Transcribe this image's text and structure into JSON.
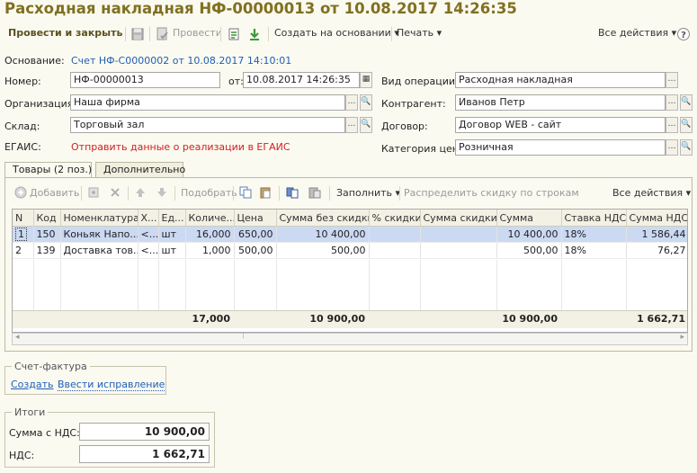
{
  "title": "Расходная накладная НФ-00000013 от 10.08.2017 14:26:35",
  "toolbar": {
    "post_close": "Провести и закрыть",
    "post": "Провести",
    "create_based": "Создать на основании",
    "print": "Печать",
    "all_actions": "Все действия"
  },
  "form": {
    "basis_label": "Основание:",
    "basis_value": "Счет НФ-С0000002 от 10.08.2017 14:10:01",
    "number_label": "Номер:",
    "number_value": "НФ-00000013",
    "date_label": "от:",
    "date_value": "10.08.2017 14:26:35",
    "org_label": "Организация:",
    "org_value": "Наша фирма",
    "warehouse_label": "Склад:",
    "warehouse_value": "Торговый зал",
    "egais_label": "ЕГАИС:",
    "egais_value": "Отправить данные о реализации в ЕГАИС",
    "op_label": "Вид операции:",
    "op_value": "Расходная накладная",
    "counterparty_label": "Контрагент:",
    "counterparty_value": "Иванов Петр",
    "contract_label": "Договор:",
    "contract_value": "Договор WEB - сайт",
    "price_cat_label": "Категория цен:",
    "price_cat_value": "Розничная"
  },
  "tabs": [
    "Товары (2 поз.)",
    "Дополнительно"
  ],
  "table_toolbar": {
    "add": "Добавить",
    "pick": "Подобрать",
    "fill": "Заполнить",
    "distribute": "Распределить скидку по строкам",
    "all_actions": "Все действия"
  },
  "table": {
    "columns": [
      "N",
      "Код",
      "Номенклатура",
      "Х...",
      "Ед...",
      "Количе...",
      "Цена",
      "Сумма без скидки",
      "% скидки",
      "Сумма скидки",
      "Сумма",
      "Ставка НДС",
      "Сумма НДС"
    ],
    "rows": [
      [
        "1",
        "150",
        "Коньяк Напо...",
        "<...",
        "шт",
        "16,000",
        "650,00",
        "10 400,00",
        "",
        "",
        "10 400,00",
        "18%",
        "1 586,44"
      ],
      [
        "2",
        "139",
        "Доставка тов...",
        "<...",
        "шт",
        "1,000",
        "500,00",
        "500,00",
        "",
        "",
        "500,00",
        "18%",
        "76,27"
      ]
    ],
    "totals": {
      "quantity": "17,000",
      "sum_no_discount": "10 900,00",
      "sum": "10 900,00",
      "vat": "1 662,71"
    }
  },
  "invoice": {
    "title": "Счет-фактура",
    "create": "Создать",
    "correction": "Ввести исправление"
  },
  "totals": {
    "title": "Итоги",
    "sum_label": "Сумма с НДС:",
    "sum_value": "10 900,00",
    "vat_label": "НДС:",
    "vat_value": "1 662,71"
  }
}
